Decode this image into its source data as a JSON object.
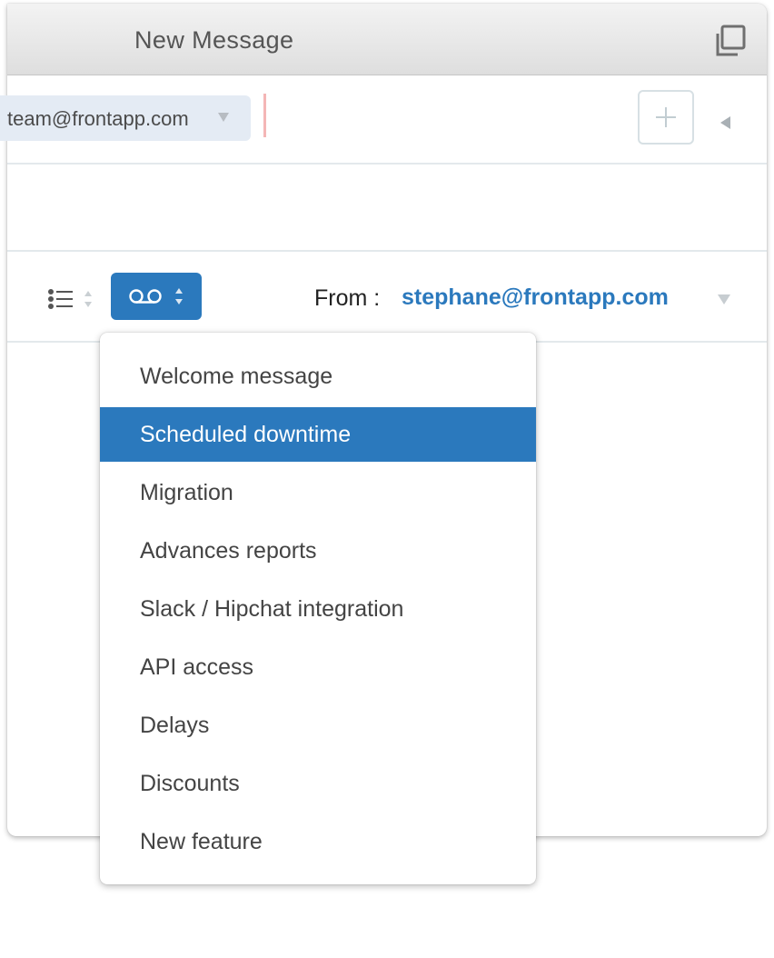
{
  "window": {
    "title": "New Message",
    "popout_icon": "popout-window-icon"
  },
  "recipients": {
    "chip_label": "team@frontapp.com",
    "chip_caret_icon": "caret-down-icon",
    "add_icon": "plus-icon",
    "collapse_icon": "caret-left-icon"
  },
  "toolbar": {
    "list_icon": "bulleted-list-icon",
    "template_icon": "voicemail-icon",
    "stepper_icon": "up-down-stepper-icon",
    "from_label": "From :",
    "from_value": "stephane@frontapp.com",
    "from_caret_icon": "caret-down-icon"
  },
  "templates_menu": {
    "selected_index": 1,
    "items": [
      {
        "label": "Welcome message"
      },
      {
        "label": "Scheduled downtime"
      },
      {
        "label": "Migration"
      },
      {
        "label": "Advances reports"
      },
      {
        "label": "Slack / Hipchat integration"
      },
      {
        "label": "API access"
      },
      {
        "label": "Delays"
      },
      {
        "label": "Discounts"
      },
      {
        "label": "New feature"
      }
    ]
  },
  "colors": {
    "accent": "#2b79bd",
    "chip_background": "#e4ebf4",
    "divider": "#e3e9ec"
  }
}
